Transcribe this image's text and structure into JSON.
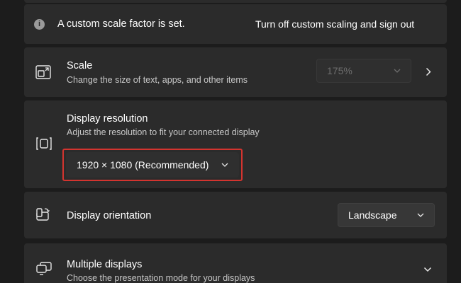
{
  "notice": {
    "text": "A custom scale factor is set.",
    "action_label": "Turn off custom scaling and sign out",
    "icon": "info-icon"
  },
  "scale": {
    "title": "Scale",
    "subtitle": "Change the size of text, apps, and other items",
    "value": "175%",
    "enabled": false,
    "icon": "scale-icon"
  },
  "resolution": {
    "title": "Display resolution",
    "subtitle": "Adjust the resolution to fit your connected display",
    "value": "1920 × 1080 (Recommended)",
    "icon": "resolution-icon",
    "highlight_color": "#d3342f"
  },
  "orientation": {
    "title": "Display orientation",
    "value": "Landscape",
    "icon": "orientation-icon"
  },
  "multiple_displays": {
    "title": "Multiple displays",
    "subtitle": "Choose the presentation mode for your displays",
    "icon": "multiple-displays-icon"
  },
  "colors": {
    "background": "#1c1c1c",
    "card": "#2b2b2b",
    "highlight": "#d3342f"
  }
}
